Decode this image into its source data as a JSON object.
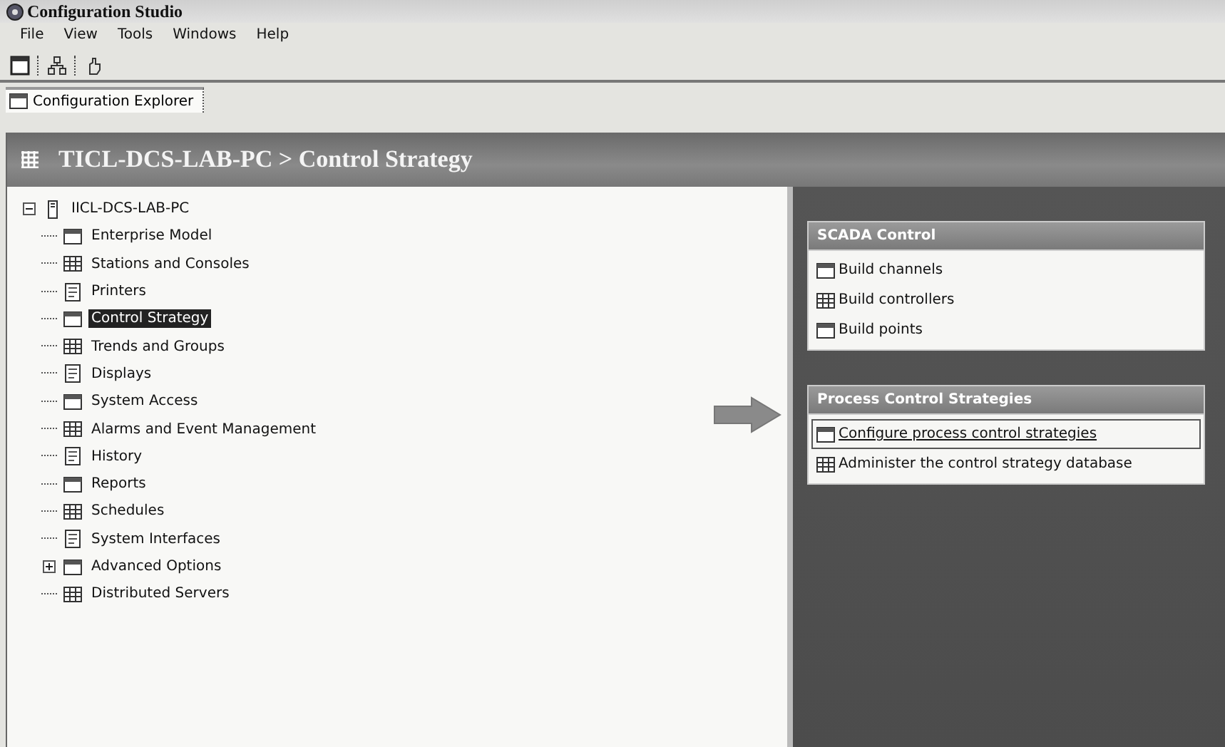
{
  "window": {
    "title": "Configuration Studio"
  },
  "menu": [
    "File",
    "View",
    "Tools",
    "Windows",
    "Help"
  ],
  "tabs": [
    {
      "label": "Configuration Explorer",
      "selected": true
    }
  ],
  "header": {
    "title": "TICL-DCS-LAB-PC > Control Strategy"
  },
  "tree": {
    "label": "IICL-DCS-LAB-PC",
    "expanded": true,
    "selected": false,
    "children": [
      {
        "label": "Enterprise Model",
        "selected": false
      },
      {
        "label": "Stations and Consoles",
        "selected": false
      },
      {
        "label": "Printers",
        "selected": false
      },
      {
        "label": "Control Strategy",
        "selected": true
      },
      {
        "label": "Trends and Groups",
        "selected": false
      },
      {
        "label": "Displays",
        "selected": false
      },
      {
        "label": "System Access",
        "selected": false
      },
      {
        "label": "Alarms and Event Management",
        "selected": false
      },
      {
        "label": "History",
        "selected": false
      },
      {
        "label": "Reports",
        "selected": false
      },
      {
        "label": "Schedules",
        "selected": false
      },
      {
        "label": "System Interfaces",
        "selected": false
      },
      {
        "label": "Advanced Options",
        "selected": false,
        "expanded": false
      },
      {
        "label": "Distributed Servers",
        "selected": false
      }
    ]
  },
  "task_panels": [
    {
      "title": "SCADA Control",
      "items": [
        {
          "label": "Build channels",
          "selected": false
        },
        {
          "label": "Build controllers",
          "selected": false
        },
        {
          "label": "Build points",
          "selected": false
        }
      ]
    },
    {
      "title": "Process Control Strategies",
      "items": [
        {
          "label": "Configure process control strategies",
          "selected": true
        },
        {
          "label": "Administer the control strategy database",
          "selected": false
        }
      ]
    }
  ]
}
